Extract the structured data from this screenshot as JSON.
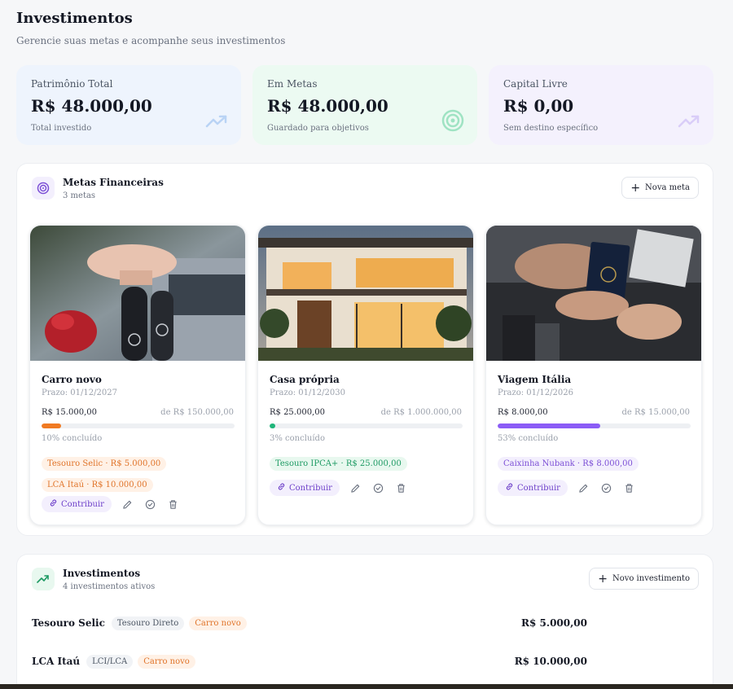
{
  "header": {
    "title": "Investimentos",
    "subtitle": "Gerencie suas metas e acompanhe seus investimentos"
  },
  "stats": [
    {
      "label": "Patrimônio Total",
      "value": "R$ 48.000,00",
      "caption": "Total investido",
      "icon": "trending-up-icon"
    },
    {
      "label": "Em Metas",
      "value": "R$ 48.000,00",
      "caption": "Guardado para objetivos",
      "icon": "target-icon"
    },
    {
      "label": "Capital Livre",
      "value": "R$ 0,00",
      "caption": "Sem destino específico",
      "icon": "trending-up-icon"
    }
  ],
  "goals_section": {
    "title": "Metas Financeiras",
    "count": "3 metas",
    "new_button": "Nova meta"
  },
  "goals": [
    {
      "name": "Carro novo",
      "deadline": "Prazo: 01/12/2027",
      "current": "R$ 15.000,00",
      "target": "de R$ 150.000,00",
      "percent_label": "10% concluído",
      "progress": 0.1,
      "bar_color": "#f07a22",
      "image": "car-keys-image",
      "tags": [
        {
          "label": "Tesouro Selic · R$ 5.000,00",
          "bg": "#fff1e6",
          "fg": "#e0742a"
        },
        {
          "label": "LCA Itaú · R$ 10.000,00",
          "bg": "#fff1e6",
          "fg": "#e0742a"
        }
      ],
      "contribute": "Contribuir"
    },
    {
      "name": "Casa própria",
      "deadline": "Prazo: 01/12/2030",
      "current": "R$ 25.000,00",
      "target": "de R$ 1.000.000,00",
      "percent_label": "3% concluído",
      "progress": 0.03,
      "bar_color": "#1fb57a",
      "image": "house-image",
      "tags": [
        {
          "label": "Tesouro IPCA+ · R$ 25.000,00",
          "bg": "#e8f8ef",
          "fg": "#1d9a63"
        }
      ],
      "contribute": "Contribuir"
    },
    {
      "name": "Viagem Itália",
      "deadline": "Prazo: 01/12/2026",
      "current": "R$ 8.000,00",
      "target": "de R$ 15.000,00",
      "percent_label": "53% concluído",
      "progress": 0.53,
      "bar_color": "#8b5cf6",
      "image": "passport-image",
      "tags": [
        {
          "label": "Caixinha Nubank · R$ 8.000,00",
          "bg": "#f3effd",
          "fg": "#7c4fd6"
        }
      ],
      "contribute": "Contribuir"
    }
  ],
  "investments_section": {
    "title": "Investimentos",
    "count": "4 investimentos ativos",
    "new_button": "Novo investimento"
  },
  "investments": [
    {
      "name": "Tesouro Selic",
      "type": "Tesouro Direto",
      "goal": "Carro novo",
      "amount": "R$ 5.000,00"
    },
    {
      "name": "LCA Itaú",
      "type": "LCI/LCA",
      "goal": "Carro novo",
      "amount": "R$ 10.000,00"
    }
  ],
  "colors": {
    "accent_purple": "#7c4fd6",
    "accent_green": "#1fb57a",
    "accent_orange": "#f07a22"
  }
}
